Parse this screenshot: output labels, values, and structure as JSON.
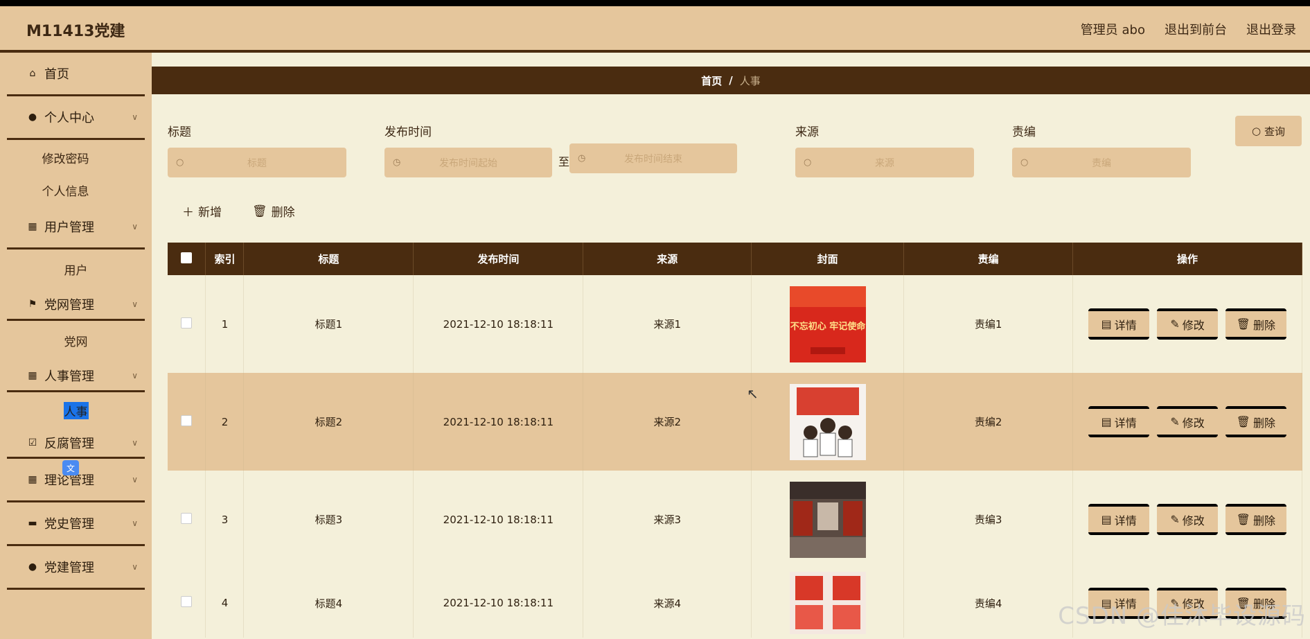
{
  "header": {
    "brand": "M11413党建",
    "links": [
      "管理员 abo",
      "退出到前台",
      "退出登录"
    ]
  },
  "sidebar": {
    "items": [
      {
        "label": "首页",
        "icon": "home-icon"
      },
      {
        "label": "个人中心",
        "icon": "user-icon"
      },
      {
        "label": "修改密码"
      },
      {
        "label": "个人信息"
      },
      {
        "label": "用户管理",
        "icon": "grid-icon"
      },
      {
        "label": "用户"
      },
      {
        "label": "党网管理",
        "icon": "flag-icon"
      },
      {
        "label": "党网"
      },
      {
        "label": "人事管理",
        "icon": "grid-icon"
      },
      {
        "label": "人事"
      },
      {
        "label": "反腐管理",
        "icon": "clipboard-check-icon"
      },
      {
        "label": "理论管理",
        "icon": "grid-icon"
      },
      {
        "label": "党史管理",
        "icon": "chat-icon"
      },
      {
        "label": "党建管理",
        "icon": "bulb-icon"
      }
    ]
  },
  "breadcrumb": {
    "home": "首页",
    "sep": "/",
    "current": "人事"
  },
  "search": {
    "title": {
      "label": "标题",
      "placeholder": "标题"
    },
    "time": {
      "label": "发布时间",
      "start_placeholder": "发布时间起始",
      "end_placeholder": "发布时间结束",
      "range_sep": "至"
    },
    "source": {
      "label": "来源",
      "placeholder": "来源"
    },
    "editor": {
      "label": "责编",
      "placeholder": "责编"
    },
    "query_label": "查询"
  },
  "toolbar": {
    "add_label": "新增",
    "delete_label": "删除"
  },
  "table": {
    "headers": [
      "索引",
      "标题",
      "发布时间",
      "来源",
      "封面",
      "责编",
      "操作"
    ],
    "rows": [
      {
        "index": "1",
        "title": "标题1",
        "time": "2021-12-10 18:18:11",
        "source": "来源1",
        "editor": "责编1"
      },
      {
        "index": "2",
        "title": "标题2",
        "time": "2021-12-10 18:18:11",
        "source": "来源2",
        "editor": "责编2"
      },
      {
        "index": "3",
        "title": "标题3",
        "time": "2021-12-10 18:18:11",
        "source": "来源3",
        "editor": "责编3"
      },
      {
        "index": "4",
        "title": "标题4",
        "time": "2021-12-10 18:18:11",
        "source": "来源4",
        "editor": "责编4"
      }
    ],
    "ops": {
      "detail": "详情",
      "edit": "修改",
      "delete": "删除"
    }
  },
  "cover_art_text": "不忘初心 牢记使命",
  "watermark": "CSDN @佳沐毕设源码",
  "colors": {
    "primary": "#4a2c10",
    "accent": "#e5c69c",
    "background": "#f4f0da"
  }
}
